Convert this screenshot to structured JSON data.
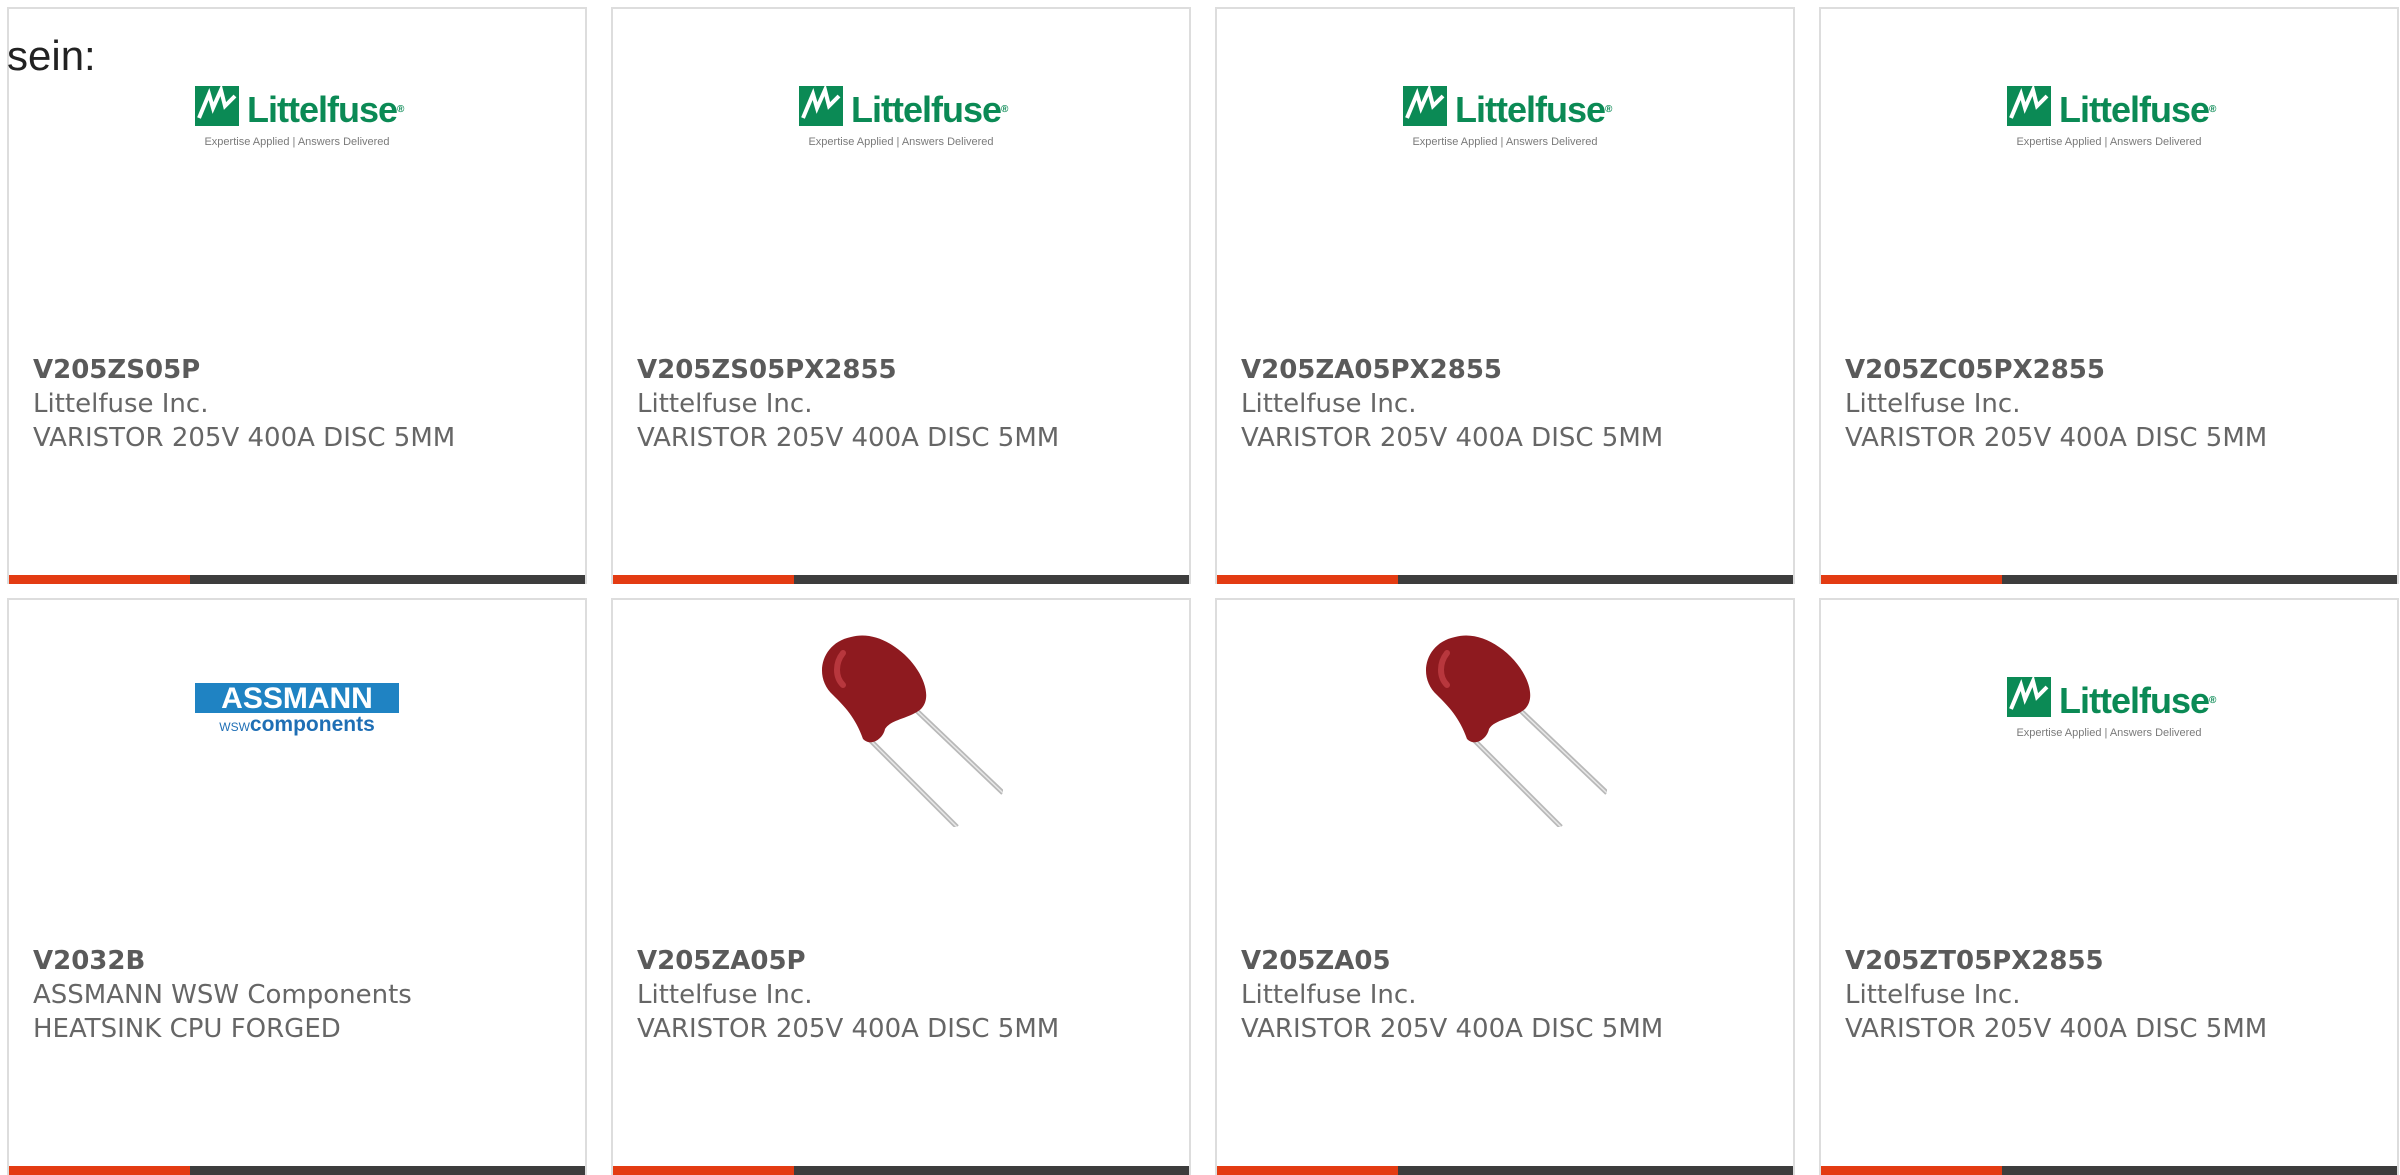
{
  "prefix_text": "sein:",
  "cards": [
    {
      "part_number": "V205ZS05P",
      "manufacturer": "Littelfuse Inc.",
      "description": "VARISTOR 205V 400A DISC 5MM",
      "image": "littelfuse-logo"
    },
    {
      "part_number": "V205ZS05PX2855",
      "manufacturer": "Littelfuse Inc.",
      "description": "VARISTOR 205V 400A DISC 5MM",
      "image": "littelfuse-logo"
    },
    {
      "part_number": "V205ZA05PX2855",
      "manufacturer": "Littelfuse Inc.",
      "description": "VARISTOR 205V 400A DISC 5MM",
      "image": "littelfuse-logo"
    },
    {
      "part_number": "V205ZC05PX2855",
      "manufacturer": "Littelfuse Inc.",
      "description": "VARISTOR 205V 400A DISC 5MM",
      "image": "littelfuse-logo"
    },
    {
      "part_number": "V2032B",
      "manufacturer": "ASSMANN WSW Components",
      "description": "HEATSINK CPU FORGED",
      "image": "assmann-logo"
    },
    {
      "part_number": "V205ZA05P",
      "manufacturer": "Littelfuse Inc.",
      "description": "VARISTOR 205V 400A DISC 5MM",
      "image": "varistor-photo"
    },
    {
      "part_number": "V205ZA05",
      "manufacturer": "Littelfuse Inc.",
      "description": "VARISTOR 205V 400A DISC 5MM",
      "image": "varistor-photo"
    },
    {
      "part_number": "V205ZT05PX2855",
      "manufacturer": "Littelfuse Inc.",
      "description": "VARISTOR 205V 400A DISC 5MM",
      "image": "littelfuse-logo"
    }
  ],
  "logos": {
    "littelfuse": {
      "wordmark": "Littelfuse",
      "registered": "®",
      "tagline": "Expertise Applied  |  Answers Delivered"
    },
    "assmann": {
      "top": "ASSMANN",
      "wsw": "WSW",
      "bottom": "components"
    }
  },
  "colors": {
    "accent": "#e33b12",
    "bar": "#3d3d3d",
    "card_border": "#dddddd",
    "text": "#666666",
    "littelfuse_green": "#0b8a55",
    "assmann_blue": "#1f83c3",
    "varistor_body": "#8e1a1f"
  }
}
